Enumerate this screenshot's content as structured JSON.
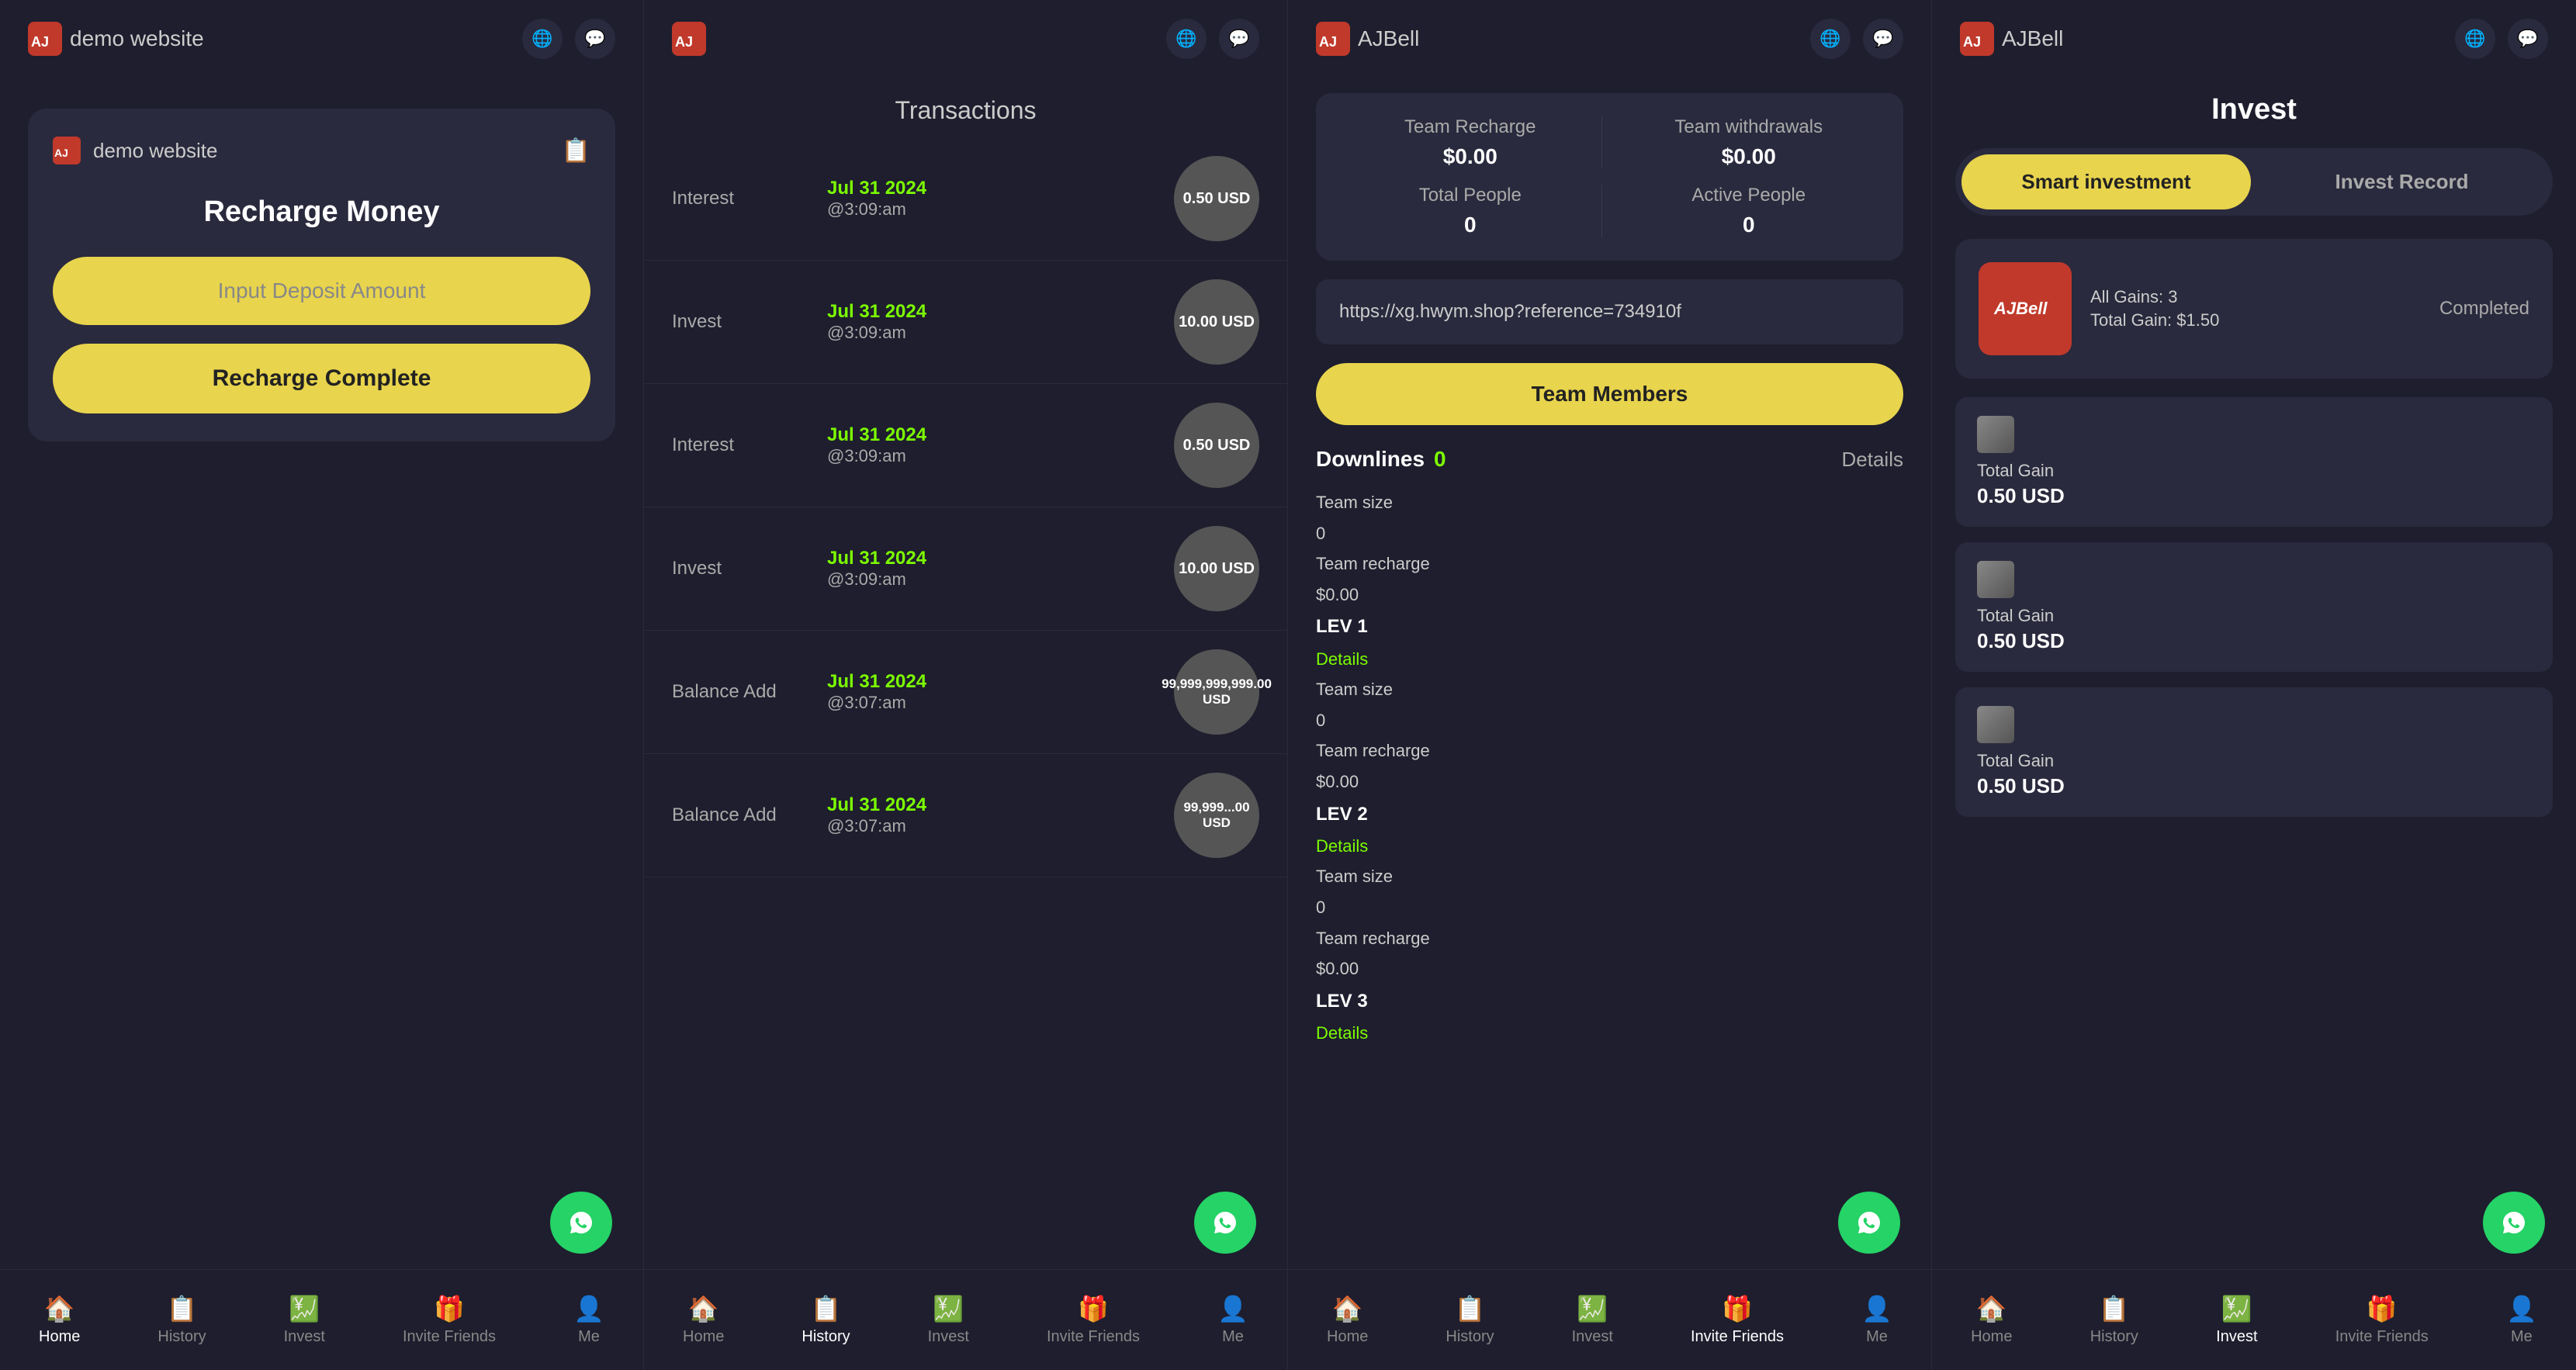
{
  "panels": [
    {
      "id": "panel1",
      "header": {
        "logo_text": "AJBell",
        "title": "demo website",
        "globe_label": "globe",
        "chat_label": "chat"
      },
      "card": {
        "site_name": "demo website",
        "title": "Recharge Money",
        "input_placeholder": "Input Deposit Amount",
        "button_label": "Recharge Complete"
      },
      "nav": [
        {
          "label": "Home",
          "icon": "🏠",
          "active": true
        },
        {
          "label": "History",
          "icon": "📋",
          "active": false
        },
        {
          "label": "Invest",
          "icon": "👤",
          "active": false
        },
        {
          "label": "Invite Friends",
          "icon": "🎁",
          "active": false
        },
        {
          "label": "Me",
          "icon": "👤",
          "active": false
        }
      ]
    },
    {
      "id": "panel2",
      "header": {
        "logo_text": "AJBell",
        "title": "",
        "globe_label": "globe",
        "chat_label": "chat"
      },
      "transactions_title": "Transactions",
      "transactions": [
        {
          "label": "Interest",
          "date": "Jul 31 2024",
          "time": "@3:09:am",
          "amount": "0.50 USD"
        },
        {
          "label": "Invest",
          "date": "Jul 31 2024",
          "time": "@3:09:am",
          "amount": "10.00 USD"
        },
        {
          "label": "Interest",
          "date": "Jul 31 2024",
          "time": "@3:09:am",
          "amount": "0.50 USD"
        },
        {
          "label": "Invest",
          "date": "Jul 31 2024",
          "time": "@3:09:am",
          "amount": "10.00 USD"
        },
        {
          "label": "Balance Add",
          "date": "Jul 31 2024",
          "time": "@3:07:am",
          "amount": "99,999,999,999.00 USD"
        },
        {
          "label": "Balance Add",
          "date": "Jul 31 2024",
          "time": "@3:07:am",
          "amount": "99,999...00 USD"
        }
      ],
      "nav": [
        {
          "label": "Home",
          "icon": "🏠",
          "active": false
        },
        {
          "label": "History",
          "icon": "📋",
          "active": true
        },
        {
          "label": "Invest",
          "icon": "👤",
          "active": false
        },
        {
          "label": "Invite Friends",
          "icon": "🎁",
          "active": false
        },
        {
          "label": "Me",
          "icon": "👤",
          "active": false
        }
      ]
    },
    {
      "id": "panel3",
      "header": {
        "logo_text": "AJBell",
        "globe_label": "globe",
        "chat_label": "chat"
      },
      "team_stats": {
        "recharge_label": "Team Recharge",
        "recharge_value": "$0.00",
        "withdrawals_label": "Team withdrawals",
        "withdrawals_value": "$0.00",
        "total_people_label": "Total People",
        "total_people_value": "0",
        "active_people_label": "Active People",
        "active_people_value": "0"
      },
      "referral_link": "https://xg.hwym.shop?reference=734910f",
      "team_members_btn": "Team Members",
      "downlines": {
        "title": "Downlines",
        "count": "0",
        "details_label": "Details"
      },
      "levels": [
        {
          "header": "LEV 1",
          "team_size_label": "Team size",
          "team_size_value": "0",
          "team_recharge_label": "Team recharge",
          "team_recharge_value": "$0.00",
          "details_label": "Details"
        },
        {
          "header": "LEV 2",
          "team_size_label": "Team size",
          "team_size_value": "0",
          "team_recharge_label": "Team recharge",
          "team_recharge_value": "$0.00",
          "details_label": "Details"
        },
        {
          "header": "LEV 3",
          "team_size_label": "Team size",
          "team_size_value": "0",
          "team_recharge_label": "Team recharge",
          "team_recharge_value": "$0.00",
          "details_label": "Details"
        }
      ],
      "nav": [
        {
          "label": "Home",
          "icon": "🏠",
          "active": false
        },
        {
          "label": "History",
          "icon": "📋",
          "active": false
        },
        {
          "label": "Invest",
          "icon": "👤",
          "active": false
        },
        {
          "label": "Invite Friends",
          "icon": "🎁",
          "active": true
        },
        {
          "label": "Me",
          "icon": "👤",
          "active": false
        }
      ]
    },
    {
      "id": "panel4",
      "header": {
        "logo_text": "AJBell",
        "globe_label": "globe",
        "chat_label": "chat"
      },
      "title": "Invest",
      "tabs": [
        {
          "label": "Smart investment",
          "active": true
        },
        {
          "label": "Invest Record",
          "active": false
        }
      ],
      "featured": {
        "logo_alt": "AJBell logo",
        "all_gains_label": "All Gains:",
        "all_gains_value": "3",
        "total_gain_label": "Total Gain:",
        "total_gain_value": "$1.50",
        "status": "Completed"
      },
      "records": [
        {
          "total_gain_label": "Total Gain",
          "total_gain_value": "0.50 USD"
        },
        {
          "total_gain_label": "Total Gain",
          "total_gain_value": "0.50 USD"
        },
        {
          "total_gain_label": "Total Gain",
          "total_gain_value": "0.50 USD"
        }
      ],
      "nav": [
        {
          "label": "Home",
          "icon": "🏠",
          "active": false
        },
        {
          "label": "History",
          "icon": "📋",
          "active": false
        },
        {
          "label": "Invest",
          "icon": "💹",
          "active": true
        },
        {
          "label": "Invite Friends",
          "icon": "🎁",
          "active": false
        },
        {
          "label": "Me",
          "icon": "👤",
          "active": false
        }
      ]
    }
  ]
}
